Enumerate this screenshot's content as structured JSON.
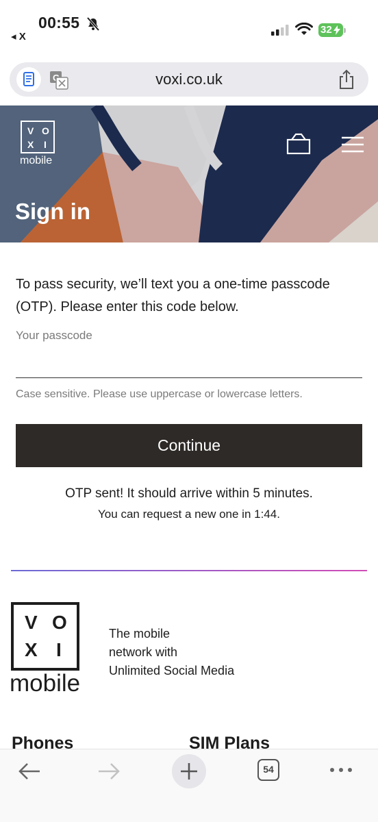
{
  "status_bar": {
    "time": "00:55",
    "back_app": "◂ X",
    "battery": "32"
  },
  "address_bar": {
    "url": "voxi.co.uk"
  },
  "hero": {
    "logo_letters": [
      "V",
      "O",
      "X",
      "I"
    ],
    "logo_word": "mobile",
    "title": "Sign in"
  },
  "form": {
    "intro": "To pass security, we’ll text you a one-time passcode (OTP). Please enter this code below.",
    "passcode_label": "Your passcode",
    "passcode_value": "",
    "hint": "Case sensitive. Please use uppercase or lowercase letters.",
    "continue_label": "Continue",
    "otp_sent": "OTP sent! It should arrive within 5 minutes.",
    "otp_resend": "You can request a new one in 1:44."
  },
  "footer": {
    "logo_letters": [
      "V",
      "O",
      "X",
      "I"
    ],
    "logo_word": "mobile",
    "tagline_lines": [
      "The mobile",
      "network with",
      "Unlimited Social Media"
    ],
    "links": [
      "Phones",
      "SIM Plans"
    ]
  },
  "toolbar": {
    "tab_count": "54"
  },
  "colors": {
    "button_bg": "#2d2a27",
    "hero_navy": "#1c2a4d",
    "hero_orange": "#bb6334",
    "hero_pink": "#cba59f",
    "hero_slate": "#52637b",
    "divider_start": "#6b6ad6",
    "divider_end": "#d14bb6"
  }
}
